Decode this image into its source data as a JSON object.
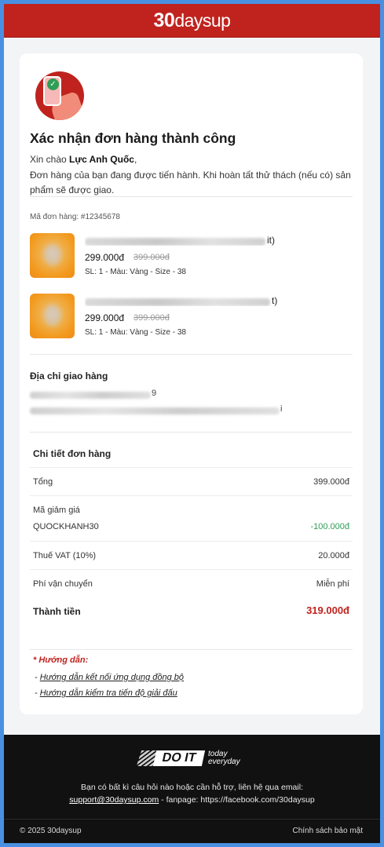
{
  "header": {
    "brand_num": "30",
    "brand_text": "daysup"
  },
  "confirmation": {
    "title": "Xác nhận đơn hàng thành công",
    "greeting_prefix": "Xin chào ",
    "customer_name": "Lực Anh Quốc",
    "greeting_suffix": ",",
    "message": "Đơn hàng của bạn đang được tiến hành. Khi hoàn tất thử thách (nếu có) sản phẩm sẽ được giao.",
    "order_code": "Mã đơn hàng: #12345678"
  },
  "products": [
    {
      "name_tail": "it)",
      "price": "299.000đ",
      "old_price": "399.000đ",
      "meta": "SL: 1 - Màu: Vàng - Size - 38"
    },
    {
      "name_tail": "t)",
      "price": "299.000đ",
      "old_price": "399.000đ",
      "meta": "SL: 1 - Màu: Vàng - Size - 38"
    }
  ],
  "shipping": {
    "title": "Địa chỉ giao hàng",
    "phone_tail": "9",
    "address_tail": "i"
  },
  "details": {
    "title": "Chi tiết đơn hàng",
    "subtotal_label": "Tổng",
    "subtotal_value": "399.000đ",
    "discount_label": "Mã giảm giá",
    "discount_code": "QUOCKHANH30",
    "discount_value": "-100.000đ",
    "vat_label": "Thuế VAT (10%)",
    "vat_value": "20.000đ",
    "shipping_label": "Phí vận chuyển",
    "shipping_value": "Miễn phí",
    "total_label": "Thành tiền",
    "total_value": "319.000đ"
  },
  "guide": {
    "title": "* Hướng dẫn:",
    "links": [
      "Hướng dẫn kết nối ứng dụng đồng bộ",
      "Hướng dẫn kiểm tra tiến độ giải đấu"
    ]
  },
  "footer": {
    "brand_main": "DO IT",
    "brand_tag1": "today",
    "brand_tag2": "everyday",
    "support_text": "Bạn có bất kì câu hỏi nào hoặc cần hỗ trợ, liên hệ qua email:",
    "email": "support@30daysup.com",
    "fanpage": " - fanpage: https://facebook.com/30daysup",
    "copyright": "© 2025 30daysup",
    "policy": "Chính sách bảo mật"
  },
  "colors": {
    "brand_red": "#c0231e",
    "discount_green": "#2e9e57",
    "footer_bg": "#111111"
  }
}
